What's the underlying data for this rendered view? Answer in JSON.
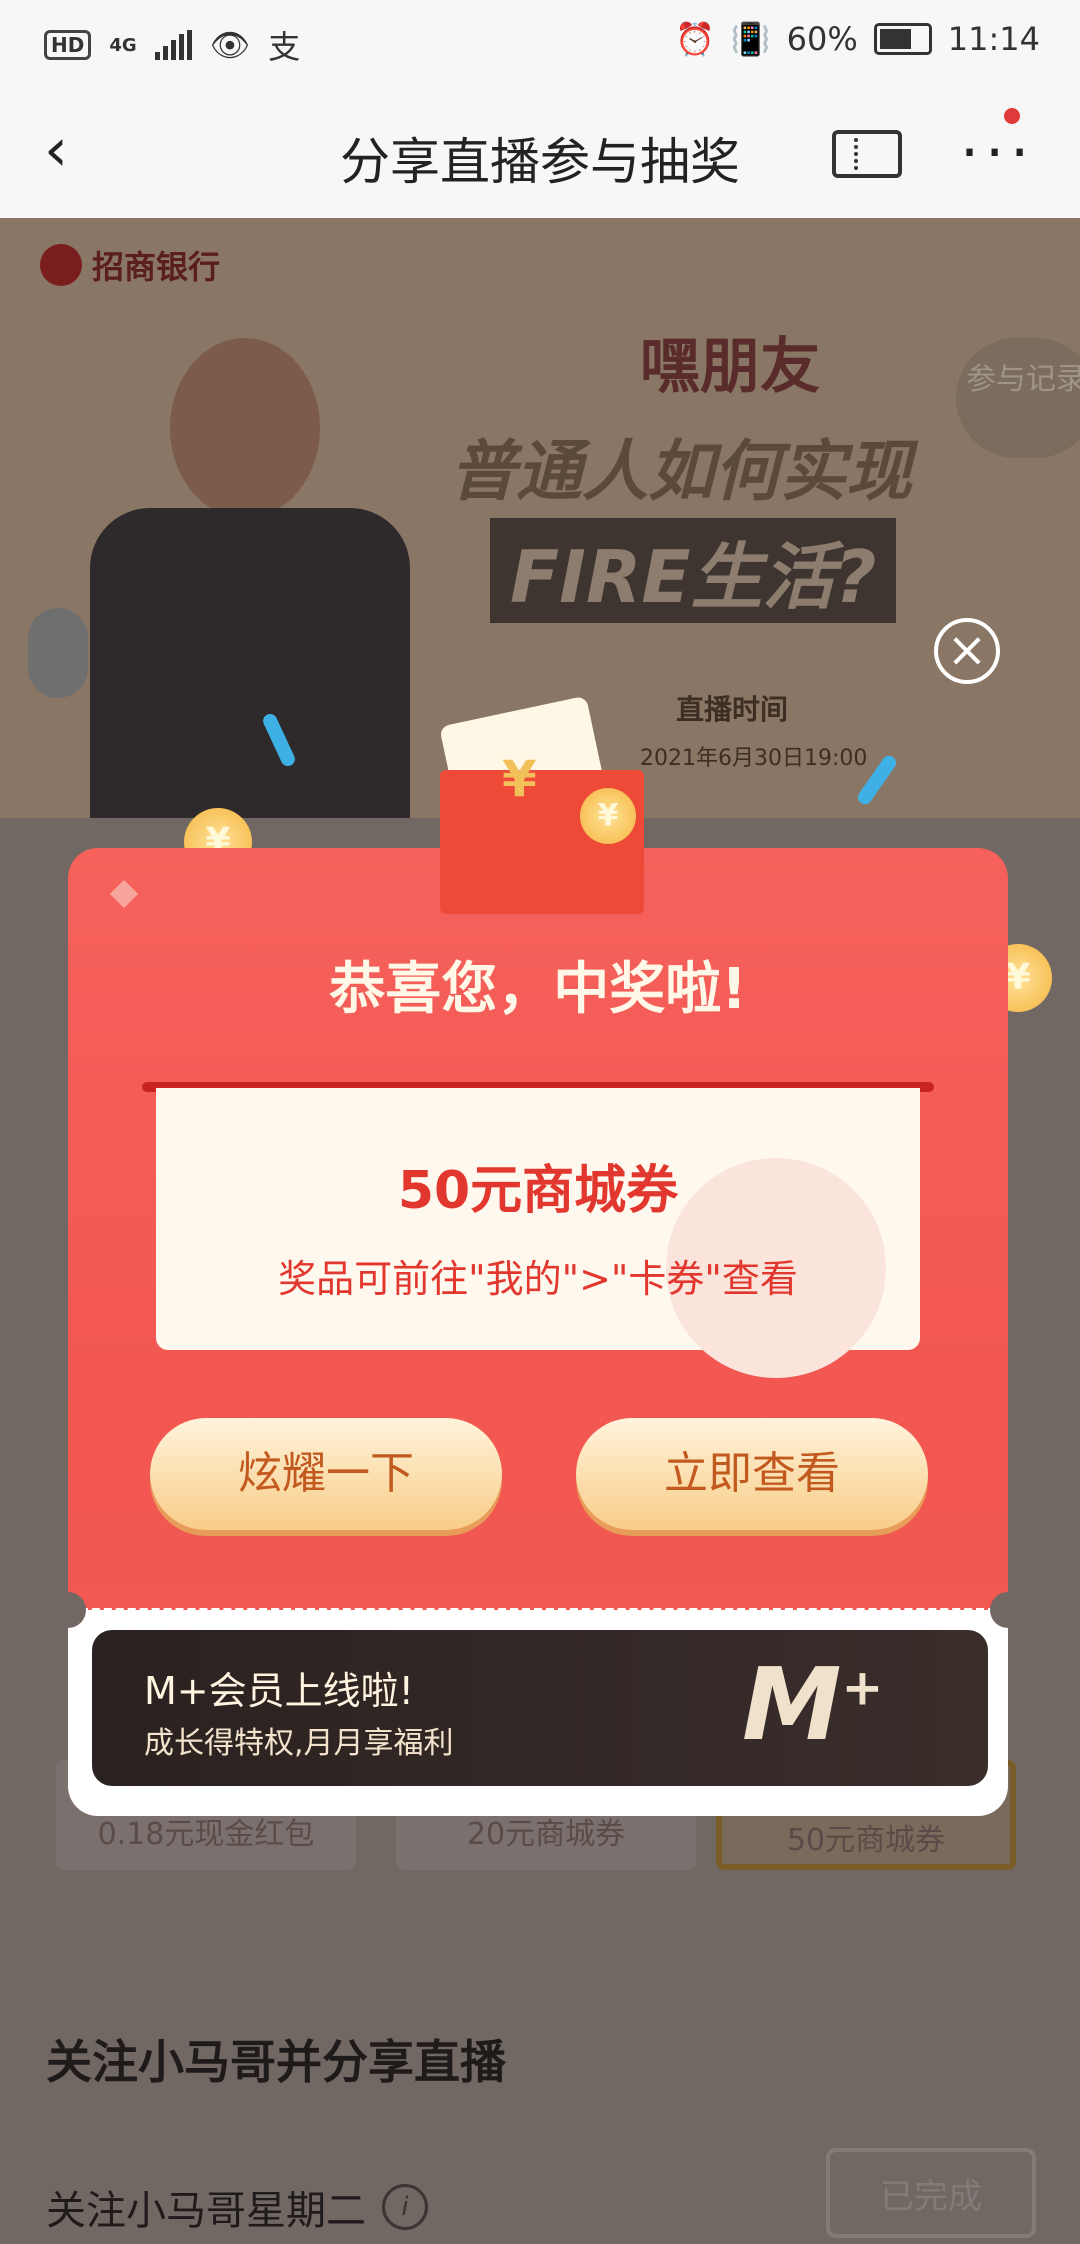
{
  "status_bar": {
    "hd": "HD",
    "network": "4G",
    "battery": "60%",
    "time": "11:14"
  },
  "nav": {
    "back_icon": "chevron-left-icon",
    "title": "分享直播参与抽奖",
    "ticket_icon": "ticket-icon",
    "more_icon": "more-dots-icon"
  },
  "banner": {
    "bank_name": "招商银行",
    "show_logo": "嘿朋友",
    "headline1": "普通人如何实现",
    "headline2": "FIRE生活?",
    "air_label": "直播时间",
    "air_time": "2021年6月30日19:00",
    "record_button": "参与记录"
  },
  "background": {
    "prizes": [
      "0.18元现金红包",
      "20元商城券",
      "50元商城券"
    ],
    "section_title": "关注小马哥并分享直播",
    "task_label": "关注小马哥星期二",
    "task_button": "已完成"
  },
  "modal": {
    "congrats": "恭喜您，中奖啦!",
    "prize_name": "50元商城券",
    "prize_hint": "奖品可前往\"我的\">\"卡券\"查看",
    "show_off_button": "炫耀一下",
    "view_button": "立即查看",
    "mplus_title": "M+会员上线啦!",
    "mplus_subtitle": "成长得特权,月月享福利",
    "mplus_logo": "M",
    "mplus_sup": "+"
  },
  "colors": {
    "modal_red": "#f25750",
    "button_gold": "#f8cd87",
    "prize_text": "#e2372e"
  }
}
